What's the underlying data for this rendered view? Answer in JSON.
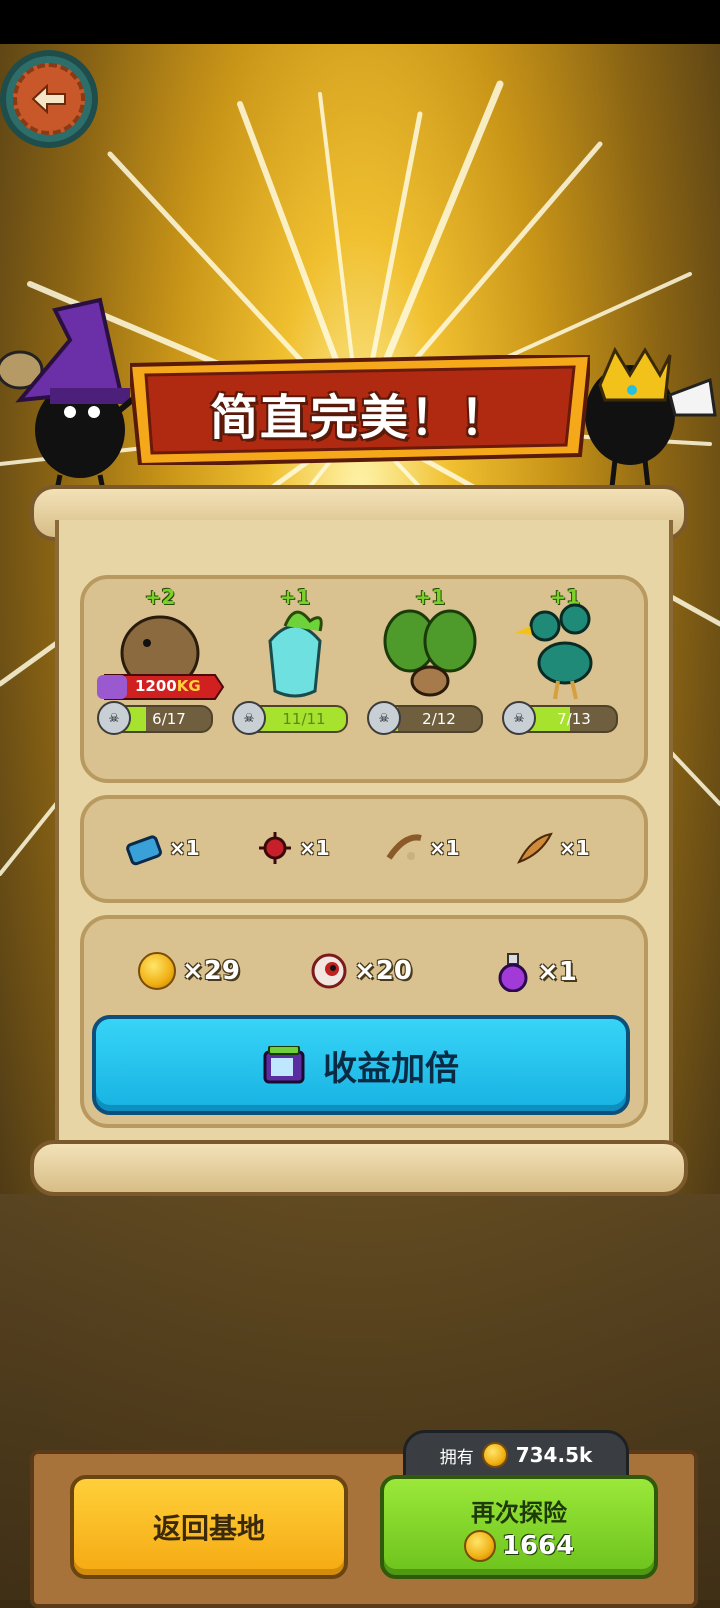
{
  "title": "简直完美！！",
  "monsters": [
    {
      "name": "potato-golem",
      "plus": "+2",
      "weight": "1200",
      "weight_unit": "KG",
      "progress_text": "6/17",
      "progress": 0.353
    },
    {
      "name": "radish-ghost",
      "plus": "+1",
      "progress_text": "11/11",
      "progress": 1.0
    },
    {
      "name": "cactus-mandrake",
      "plus": "+1",
      "progress_text": "2/12",
      "progress": 0.167
    },
    {
      "name": "two-headed-bird",
      "plus": "+1",
      "progress_text": "7/13",
      "progress": 0.538
    }
  ],
  "items": [
    {
      "icon": "blue-device-icon",
      "count": "×1"
    },
    {
      "icon": "red-spiky-creature-icon",
      "count": "×1"
    },
    {
      "icon": "slingshot-icon",
      "count": "×1"
    },
    {
      "icon": "feather-icon",
      "count": "×1"
    }
  ],
  "rewards": [
    {
      "icon": "coin-icon",
      "count": "×29"
    },
    {
      "icon": "eyeball-icon",
      "count": "×20"
    },
    {
      "icon": "potion-icon",
      "count": "×1"
    }
  ],
  "double_button": {
    "label": "收益加倍",
    "icon": "tv-ad-icon"
  },
  "owned": {
    "label": "拥有",
    "value": "734.5k"
  },
  "return_button": {
    "label": "返回基地"
  },
  "again_button": {
    "label": "再次探险",
    "cost": "1664"
  },
  "colors": {
    "accent_blue": "#1ec0ec",
    "accent_green": "#7ad12a",
    "accent_yellow": "#f5b91e",
    "banner_red": "#b02a12"
  }
}
